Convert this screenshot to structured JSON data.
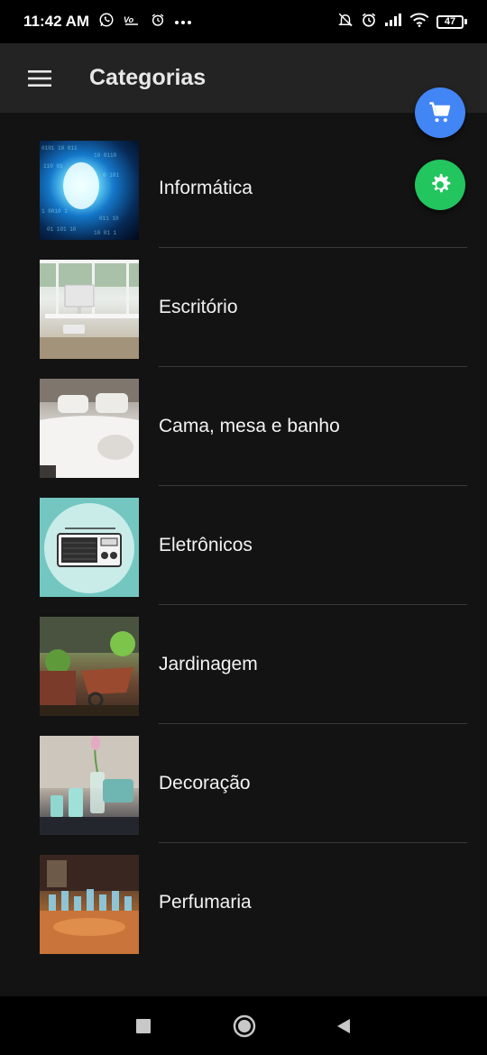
{
  "status_bar": {
    "time": "11:42 AM",
    "battery_level": "47",
    "icons_left": [
      "whatsapp-icon",
      "signal-badge-icon",
      "alarm-icon",
      "more-dots-icon"
    ],
    "icons_right": [
      "notifications-off-icon",
      "alarm-icon",
      "cell-signal-icon",
      "wifi-icon",
      "battery-icon"
    ]
  },
  "app_bar": {
    "title": "Categorias",
    "menu_icon": "menu-icon"
  },
  "fabs": {
    "cart": {
      "icon": "cart-icon",
      "color": "#4285f4"
    },
    "settings": {
      "icon": "gear-icon",
      "color": "#22c55e"
    }
  },
  "categories": [
    {
      "label": "Informática",
      "thumb": "tunnel-data-image"
    },
    {
      "label": "Escritório",
      "thumb": "office-desk-image"
    },
    {
      "label": "Cama, mesa e banho",
      "thumb": "bedroom-image"
    },
    {
      "label": "Eletrônicos",
      "thumb": "radio-image"
    },
    {
      "label": "Jardinagem",
      "thumb": "garden-cart-image"
    },
    {
      "label": "Decoração",
      "thumb": "flower-vase-image"
    },
    {
      "label": "Perfumaria",
      "thumb": "perfume-bottles-image"
    }
  ],
  "nav_bar": {
    "recents": "recents-square-icon",
    "home": "home-circle-icon",
    "back": "back-triangle-icon"
  },
  "colors": {
    "background": "#131313",
    "app_bar": "#232323",
    "divider": "#3a3a3a"
  }
}
